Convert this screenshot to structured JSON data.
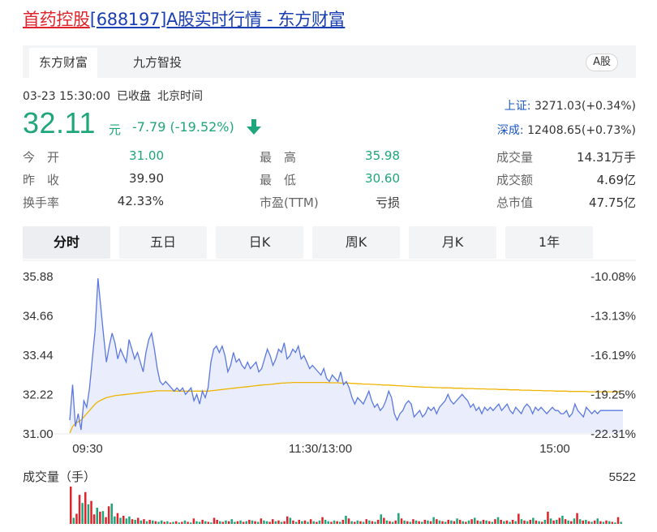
{
  "header": {
    "name": "首药控股",
    "rest": "[688197]A股实时行情 - 东方财富"
  },
  "source_tabs": [
    "东方财富",
    "九方智投"
  ],
  "badge": "A股",
  "quote": {
    "time": "03-23 15:30:00",
    "status": "已收盘",
    "tz": "北京时间",
    "price": "32.11",
    "unit": "元",
    "change": "-7.79 (-19.52%)"
  },
  "indices": [
    {
      "name": "上证:",
      "value": "3271.03(+0.34%)"
    },
    {
      "name": "深成:",
      "value": "12408.65(+0.73%)"
    }
  ],
  "stats": [
    {
      "label": "今　开",
      "value": "31.00",
      "tone": "green"
    },
    {
      "label": "最　高",
      "value": "35.98",
      "tone": "green"
    },
    {
      "label": "成交量",
      "value": "14.31万手",
      "tone": "dark"
    },
    {
      "label": "昨　收",
      "value": "39.90",
      "tone": "dark"
    },
    {
      "label": "最　低",
      "value": "30.60",
      "tone": "green"
    },
    {
      "label": "成交额",
      "value": "4.69亿",
      "tone": "dark"
    },
    {
      "label": "换手率",
      "value": "42.33%",
      "tone": "dark"
    },
    {
      "label": "市盈(TTM)",
      "value": "亏损",
      "tone": "dark"
    },
    {
      "label": "总市值",
      "value": "47.75亿",
      "tone": "dark"
    }
  ],
  "periods": [
    "分时",
    "五日",
    "日K",
    "周K",
    "月K",
    "1年"
  ],
  "chart_data": {
    "type": "line",
    "y_left_ticks": [
      "35.88",
      "34.66",
      "33.44",
      "32.22",
      "31.00"
    ],
    "y_right_ticks": [
      "-10.08%",
      "-13.13%",
      "-16.19%",
      "-19.25%",
      "-22.31%"
    ],
    "ylim": [
      31.0,
      35.88
    ],
    "x_ticks": [
      "09:30",
      "11:30/13:00",
      "15:00"
    ],
    "volume_label": "成交量（手）",
    "volume_max": "5522",
    "colors": {
      "price": "#5b78e0",
      "avg": "#f0b400",
      "fill": "#dfe5fb",
      "up": "#e0232b",
      "down": "#1fa67a"
    },
    "price": [
      31.4,
      32.5,
      31.2,
      31.6,
      31.1,
      32.0,
      31.8,
      32.4,
      33.3,
      34.2,
      35.8,
      34.9,
      34.0,
      33.2,
      33.7,
      34.1,
      33.8,
      33.3,
      33.6,
      33.4,
      33.2,
      33.9,
      33.6,
      33.3,
      33.5,
      33.2,
      32.9,
      33.5,
      33.9,
      34.1,
      33.6,
      33.0,
      32.6,
      32.5,
      32.6,
      32.5,
      32.4,
      32.3,
      32.4,
      32.3,
      32.4,
      32.2,
      32.3,
      32.4,
      32.0,
      32.2,
      31.9,
      32.3,
      32.1,
      32.4,
      33.2,
      33.6,
      33.7,
      33.5,
      33.7,
      33.4,
      32.9,
      33.1,
      33.5,
      33.2,
      33.3,
      33.1,
      33.0,
      33.2,
      33.0,
      33.1,
      33.2,
      32.9,
      33.0,
      33.3,
      33.6,
      33.4,
      33.1,
      33.3,
      33.6,
      33.5,
      33.8,
      33.3,
      33.4,
      33.6,
      33.5,
      33.7,
      33.3,
      33.4,
      33.2,
      33.0,
      33.1,
      33.0,
      32.9,
      32.8,
      33.0,
      32.7,
      32.6,
      32.8,
      32.7,
      32.6,
      32.9,
      32.5,
      32.6,
      32.4,
      32.1,
      31.9,
      32.1,
      32.0,
      31.9,
      32.1,
      32.3,
      32.0,
      31.8,
      31.9,
      31.7,
      31.8,
      32.0,
      32.3,
      32.1,
      31.6,
      31.4,
      31.6,
      31.7,
      31.9,
      32.0,
      31.9,
      31.5,
      31.6,
      31.7,
      31.5,
      31.6,
      31.8,
      31.7,
      31.8,
      31.6,
      31.8,
      31.9,
      32.0,
      32.2,
      32.0,
      31.9,
      32.0,
      32.1,
      32.2,
      32.1,
      32.0,
      31.8,
      31.9,
      31.7,
      31.8,
      31.6,
      31.8,
      31.7,
      31.8,
      31.7,
      31.8,
      31.9,
      31.7,
      31.8,
      31.9,
      31.7,
      31.6,
      31.8,
      31.7,
      31.6,
      31.8,
      31.9,
      31.8,
      31.6,
      31.8,
      31.7,
      31.8,
      31.7,
      31.6,
      31.7,
      31.8,
      31.7,
      31.7,
      31.6,
      31.6,
      31.7,
      31.5,
      31.6,
      31.9,
      31.7,
      31.6,
      31.5,
      31.8,
      31.7,
      31.6,
      31.7,
      31.6,
      31.7,
      31.7,
      31.7,
      31.7,
      31.7,
      31.7,
      31.7,
      31.7,
      31.7
    ],
    "avg": [
      31.0,
      31.2,
      31.3,
      31.35,
      31.4,
      31.5,
      31.6,
      31.7,
      31.8,
      31.9,
      31.97,
      32.02,
      32.06,
      32.1,
      32.12,
      32.14,
      32.16,
      32.17,
      32.18,
      32.19,
      32.2,
      32.21,
      32.22,
      32.23,
      32.24,
      32.25,
      32.26,
      32.27,
      32.28,
      32.29,
      32.3,
      32.31,
      32.31,
      32.31,
      32.31,
      32.31,
      32.31,
      32.3,
      32.3,
      32.3,
      32.3,
      32.3,
      32.3,
      32.3,
      32.3,
      32.3,
      32.3,
      32.3,
      32.3,
      32.3,
      32.31,
      32.32,
      32.33,
      32.34,
      32.35,
      32.36,
      32.37,
      32.38,
      32.39,
      32.4,
      32.41,
      32.42,
      32.43,
      32.44,
      32.45,
      32.46,
      32.47,
      32.48,
      32.49,
      32.5,
      32.5,
      32.51,
      32.52,
      32.53,
      32.54,
      32.55,
      32.55,
      32.56,
      32.56,
      32.57,
      32.57,
      32.57,
      32.57,
      32.57,
      32.57,
      32.57,
      32.57,
      32.57,
      32.57,
      32.57,
      32.57,
      32.57,
      32.56,
      32.56,
      32.56,
      32.56,
      32.55,
      32.55,
      32.55,
      32.55,
      32.54,
      32.54,
      32.53,
      32.53,
      32.52,
      32.52,
      32.52,
      32.51,
      32.51,
      32.5,
      32.5,
      32.49,
      32.49,
      32.49,
      32.48,
      32.48,
      32.47,
      32.47,
      32.46,
      32.46,
      32.45,
      32.45,
      32.44,
      32.44,
      32.43,
      32.43,
      32.42,
      32.42,
      32.42,
      32.41,
      32.41,
      32.41,
      32.4,
      32.4,
      32.4,
      32.4,
      32.39,
      32.39,
      32.39,
      32.39,
      32.38,
      32.38,
      32.38,
      32.38,
      32.37,
      32.37,
      32.37,
      32.37,
      32.36,
      32.36,
      32.36,
      32.36,
      32.35,
      32.35,
      32.35,
      32.35,
      32.34,
      32.34,
      32.34,
      32.34,
      32.33,
      32.33,
      32.33,
      32.33,
      32.32,
      32.32,
      32.32,
      32.32,
      32.31,
      32.31,
      32.31,
      32.31,
      32.3,
      32.3,
      32.3,
      32.3,
      32.3,
      32.29,
      32.29,
      32.29,
      32.29,
      32.29,
      32.29,
      32.29,
      32.28,
      32.28,
      32.28,
      32.28,
      32.28,
      32.28,
      32.28,
      32.28,
      32.28,
      32.28,
      32.28,
      32.28
    ],
    "volume": [
      5522,
      900,
      1500,
      4300,
      3100,
      4700,
      2900,
      3400,
      1400,
      2400,
      1800,
      1900,
      1000,
      2600,
      3000,
      1100,
      1600,
      900,
      1200,
      800,
      1100,
      700,
      600,
      900,
      500,
      700,
      400,
      600,
      500,
      400,
      300,
      500,
      300,
      400,
      200,
      300,
      400,
      200,
      300,
      500,
      300,
      200,
      800,
      400,
      300,
      600,
      400,
      300,
      200,
      900,
      600,
      400,
      300,
      500,
      400,
      700,
      300,
      400,
      500,
      300,
      400,
      600,
      500,
      400,
      300,
      800,
      500,
      400,
      300,
      700,
      400,
      500,
      300,
      400,
      1100,
      900,
      500,
      300,
      600,
      400,
      500,
      300,
      700,
      400,
      300,
      500,
      1000,
      600,
      400,
      300,
      500,
      400,
      300,
      600,
      1200,
      800,
      400,
      300,
      500,
      400,
      300,
      700,
      500,
      400,
      300,
      600,
      1400,
      900,
      500,
      400,
      300,
      500,
      1600,
      800,
      500,
      400,
      300,
      700,
      500,
      400,
      300,
      600,
      500,
      400,
      1000,
      700,
      500,
      400,
      300,
      600,
      500,
      400,
      800,
      600,
      400,
      300,
      500,
      700,
      900,
      500,
      400,
      600,
      500,
      400,
      300,
      700,
      1000,
      600,
      400,
      500,
      300,
      600,
      400,
      1500,
      700,
      500,
      400,
      600,
      900,
      500,
      400,
      300,
      600,
      1800,
      800,
      500,
      600,
      900,
      1200,
      700,
      500,
      400,
      800,
      1600,
      700,
      500,
      600,
      400,
      300,
      500,
      800,
      400,
      300,
      500,
      400,
      300,
      200,
      1000,
      300
    ],
    "vol_up": [
      true,
      false,
      true,
      true,
      false,
      true,
      false,
      true,
      true,
      false,
      true,
      false,
      true,
      true,
      false,
      false,
      true,
      false,
      true,
      false,
      false,
      true,
      false,
      true,
      false,
      true,
      false,
      true,
      false,
      true,
      false,
      false,
      true,
      false,
      true,
      false,
      true,
      false,
      true,
      false,
      true,
      false,
      true,
      false,
      false,
      true,
      false,
      true,
      false,
      true,
      true,
      false,
      true,
      false,
      true,
      false,
      false,
      true,
      false,
      true,
      false,
      true,
      false,
      true,
      false,
      true,
      false,
      false,
      true,
      true,
      false,
      true,
      false,
      true,
      true,
      false,
      true,
      false,
      true,
      false,
      true,
      false,
      true,
      false,
      true,
      false,
      true,
      false,
      false,
      true,
      false,
      true,
      false,
      true,
      false,
      true,
      false,
      true,
      false,
      true,
      false,
      true,
      false,
      true,
      false,
      true,
      false,
      true,
      false,
      true,
      false,
      true,
      false,
      true,
      false,
      true,
      false,
      true,
      false,
      true,
      false,
      true,
      false,
      true,
      false,
      true,
      false,
      true,
      false,
      true,
      false,
      true,
      false,
      true,
      false,
      true,
      false,
      true,
      false,
      true,
      false,
      true,
      false,
      true,
      false,
      true,
      false,
      true,
      false,
      true,
      false,
      true,
      false,
      true,
      false,
      true,
      false,
      true,
      false,
      true,
      false,
      true,
      false,
      true,
      false,
      true,
      false,
      true,
      false,
      true,
      false,
      true,
      false,
      true,
      false,
      true,
      false,
      true,
      false,
      true,
      false,
      true,
      false,
      true,
      false,
      true,
      false,
      true,
      false,
      true,
      false,
      true,
      false,
      true,
      false,
      true
    ]
  }
}
